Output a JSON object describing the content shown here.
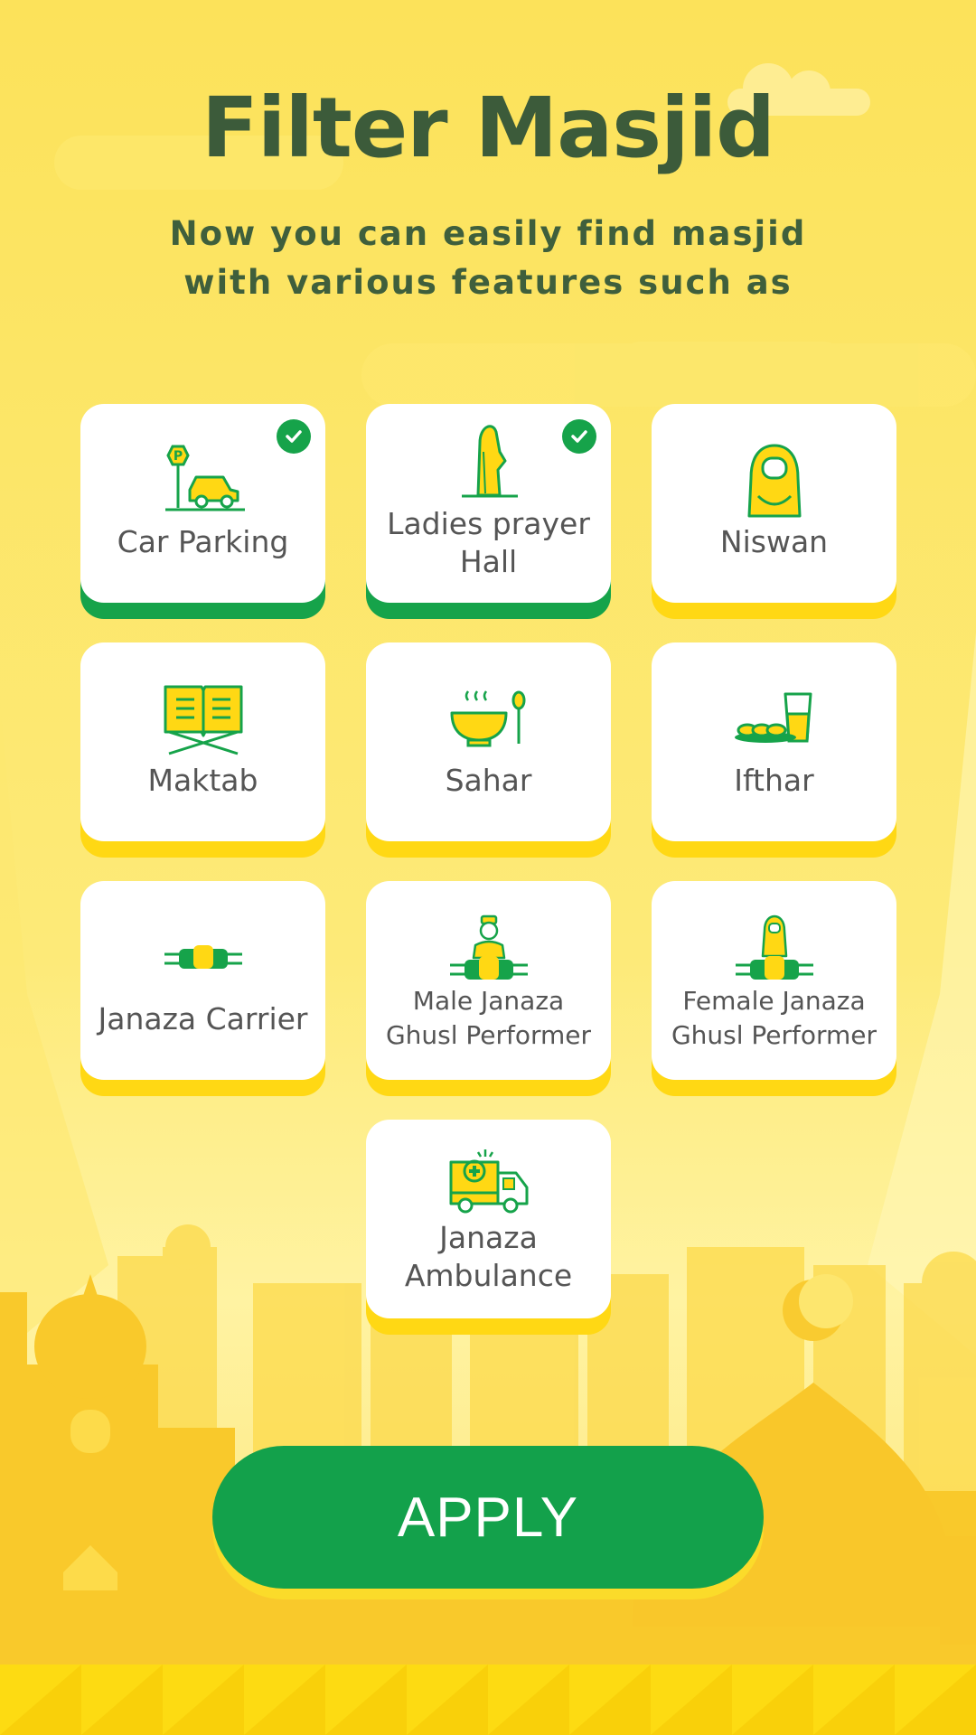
{
  "page": {
    "title": "Filter Masjid",
    "subtitle": "Now you can easily find masjid with various features such as"
  },
  "features": [
    {
      "label": "Car Parking",
      "icon": "car-parking-icon",
      "selected": true
    },
    {
      "label": "Ladies prayer Hall",
      "icon": "ladies-prayer-hall-icon",
      "selected": true
    },
    {
      "label": "Niswan",
      "icon": "niswan-icon",
      "selected": false
    },
    {
      "label": "Maktab",
      "icon": "maktab-quran-icon",
      "selected": false
    },
    {
      "label": "Sahar",
      "icon": "sahar-bowl-icon",
      "selected": false
    },
    {
      "label": "Ifthar",
      "icon": "ifthar-dates-icon",
      "selected": false
    },
    {
      "label": "Janaza Carrier",
      "icon": "janaza-carrier-icon",
      "selected": false
    },
    {
      "label": "Male Janaza Ghusl Performer",
      "icon": "male-ghusl-performer-icon",
      "selected": false
    },
    {
      "label": "Female Janaza Ghusl Performer",
      "icon": "female-ghusl-performer-icon",
      "selected": false
    },
    {
      "label": "Janaza Ambulance",
      "icon": "janaza-ambulance-icon",
      "selected": false
    }
  ],
  "apply_button": {
    "label": "APPLY"
  },
  "colors": {
    "background": "#FCE356",
    "title_text": "#3C5B3A",
    "selected_accent": "#16A34A",
    "card_shadow": "#FFD814",
    "apply_button": "#13A14B"
  }
}
